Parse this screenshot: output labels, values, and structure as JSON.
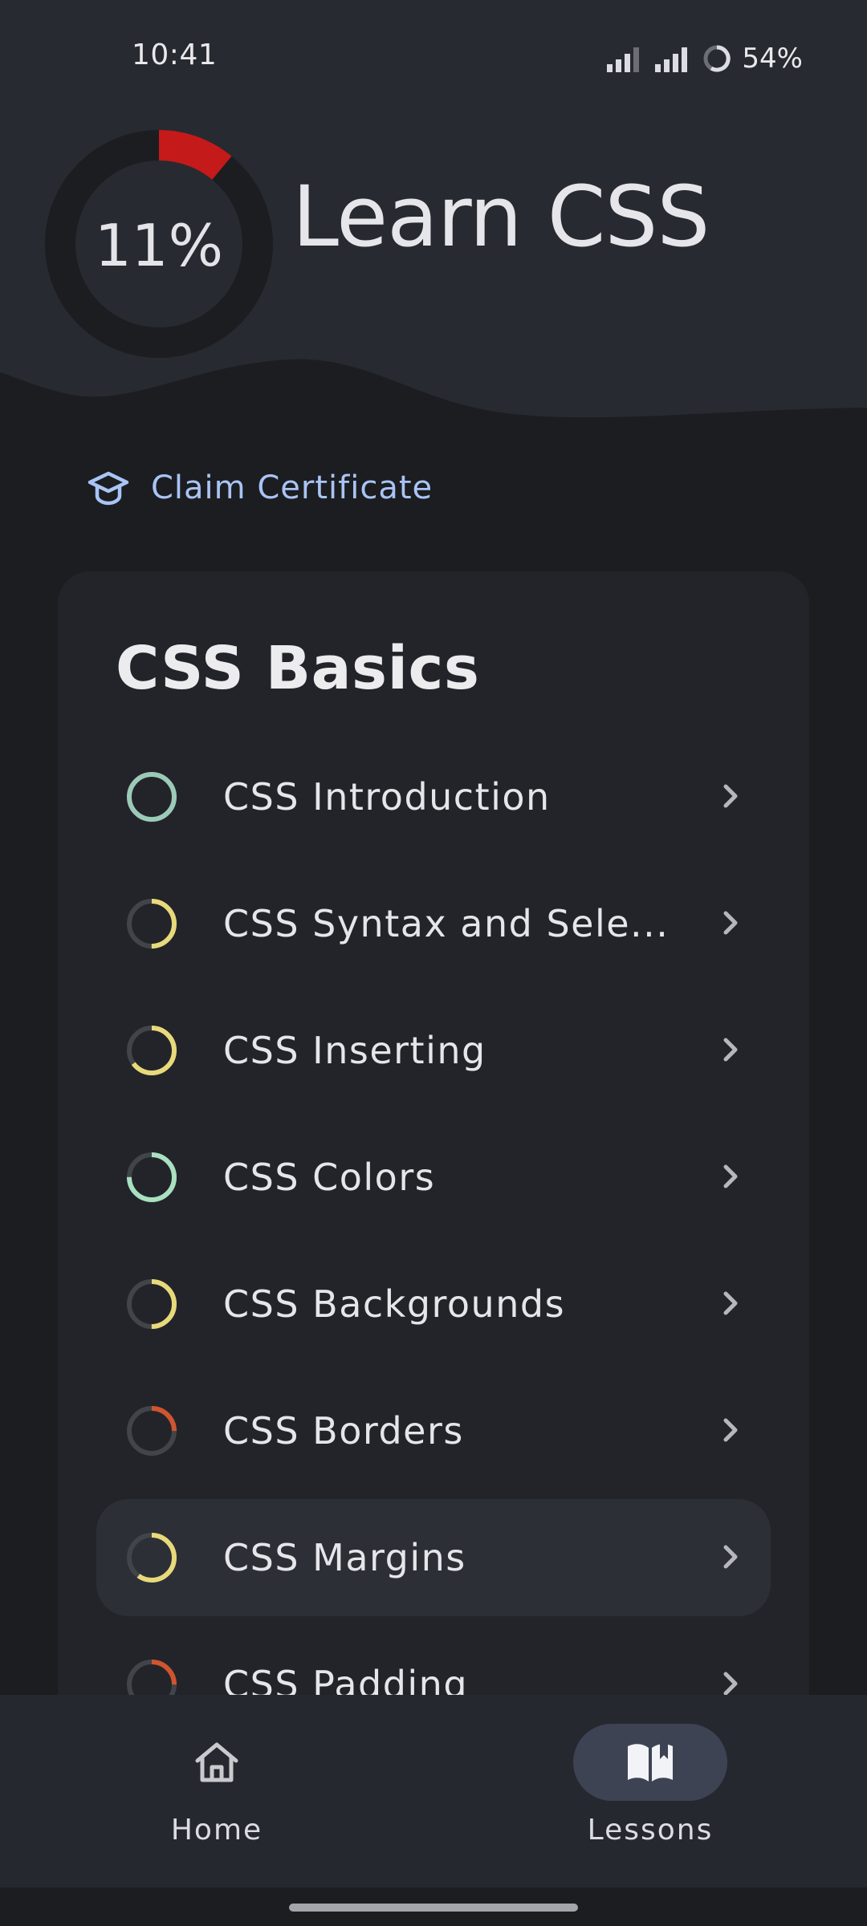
{
  "colors": {
    "header_bg": "#272a31",
    "page_bg": "#1c1d20",
    "card_bg": "#232429",
    "progress_red": "#c41a1a",
    "ring_track": "#414449",
    "ring_teal": "#9ccab8",
    "ring_green": "#a8e0c0",
    "ring_yellow": "#e8d97a",
    "ring_orange": "#d0542e",
    "link_blue": "#a9c4f5"
  },
  "status_bar": {
    "time": "10:41",
    "battery": "54%"
  },
  "header": {
    "progress": 11,
    "progress_label": "11%",
    "title": "Learn CSS"
  },
  "certificate": {
    "icon": "graduation-cap-icon",
    "label": "Claim Certificate"
  },
  "section": {
    "title": "CSS Basics",
    "lessons": [
      {
        "label": "CSS Introduction",
        "progress": 1.0,
        "color": "#9ccab8",
        "selected": false
      },
      {
        "label": "CSS Syntax and Sele...",
        "progress": 0.5,
        "color": "#e8d97a",
        "selected": false
      },
      {
        "label": "CSS Inserting",
        "progress": 0.65,
        "color": "#e8d97a",
        "selected": false
      },
      {
        "label": "CSS Colors",
        "progress": 0.75,
        "color": "#a8e0c0",
        "selected": false
      },
      {
        "label": "CSS Backgrounds",
        "progress": 0.5,
        "color": "#e8d97a",
        "selected": false
      },
      {
        "label": "CSS Borders",
        "progress": 0.25,
        "color": "#d0542e",
        "selected": false
      },
      {
        "label": "CSS Margins",
        "progress": 0.6,
        "color": "#e8d97a",
        "selected": true
      },
      {
        "label": "CSS Padding",
        "progress": 0.25,
        "color": "#d0542e",
        "selected": false
      }
    ]
  },
  "bottom_nav": {
    "items": [
      {
        "label": "Home",
        "icon": "home-icon",
        "active": false
      },
      {
        "label": "Lessons",
        "icon": "book-icon",
        "active": true
      }
    ]
  }
}
